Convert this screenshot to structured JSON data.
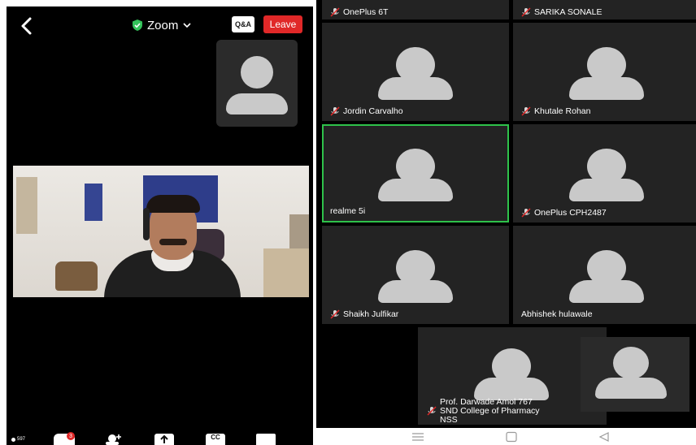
{
  "header": {
    "app_title": "Zoom",
    "qa_label": "Q&A",
    "leave_label": "Leave"
  },
  "toolbar": {
    "participant_count": "597",
    "chat_badge": "3",
    "cc_label": "CC"
  },
  "gallery": {
    "top_partial": [
      {
        "name": "OnePlus 6T"
      },
      {
        "name": "SARIKA SONALE"
      }
    ],
    "tiles": [
      {
        "name": "Jordin Carvalho",
        "muted": true
      },
      {
        "name": "Khutale Rohan",
        "muted": true
      },
      {
        "name": "realme 5i",
        "muted": false,
        "active": true
      },
      {
        "name": "OnePlus CPH2487",
        "muted": true
      },
      {
        "name": "Shaikh Julfikar",
        "muted": true
      },
      {
        "name": "Abhishek hulawale",
        "muted": false
      }
    ],
    "bottom_tile": {
      "line1": "Prof. Darwade Amol 767",
      "line2": "SND College of Pharmacy",
      "line3": "NSS"
    }
  },
  "colors": {
    "leave_red": "#e02828",
    "active_border": "#2ec24a",
    "tile_bg": "#232323",
    "avatar_gray": "#c9c9c9"
  },
  "icons": {
    "back": "chevron-left-icon",
    "secure": "shield-check-icon",
    "dropdown": "chevron-down-icon",
    "mute": "muted-mic-icon",
    "nav_menu": "menu-icon",
    "nav_home": "square-icon",
    "nav_back": "triangle-back-icon"
  }
}
